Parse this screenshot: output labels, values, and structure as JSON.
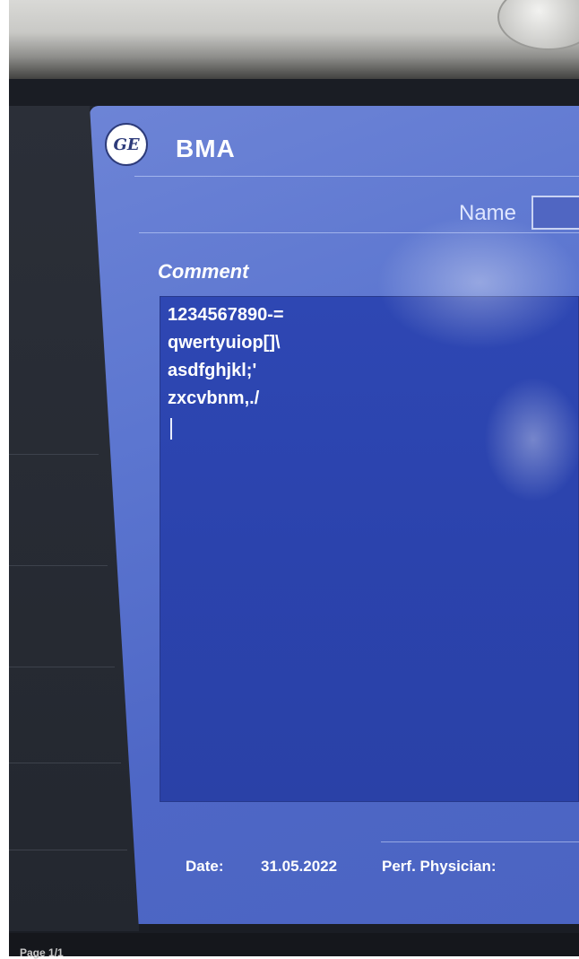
{
  "dialog": {
    "title": "BMA",
    "logo_text": "GE",
    "name_label": "Name",
    "name_value": "",
    "comment_label": "Comment",
    "comment_lines": [
      "1234567890-=",
      "qwertyuiop[]\\",
      "asdfghjkl;'",
      "zxcvbnm,./"
    ],
    "date_label": "Date:",
    "date_value": "31.05.2022",
    "physician_label": "Perf. Physician:"
  },
  "status_bar": {
    "page_text": "Page 1/1"
  },
  "colors": {
    "dialog_bg": "#5c76d0",
    "comment_bg": "#2e47b3",
    "text": "#ffffff"
  }
}
